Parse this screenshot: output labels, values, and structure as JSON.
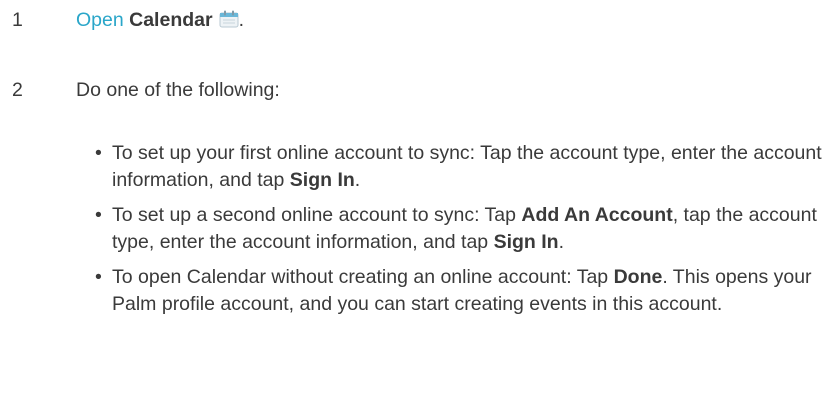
{
  "steps": [
    {
      "number": "1",
      "link_text": "Open",
      "app_name": "Calendar",
      "suffix": "."
    },
    {
      "number": "2",
      "text": "Do one of the following:"
    }
  ],
  "bullet_symbol": "•",
  "bullets": [
    {
      "lead": "To set up your first online account to sync: Tap the account type, enter the account information, and tap ",
      "bold": "Sign In",
      "tail": "."
    },
    {
      "part1": "To set up a second online account to sync: Tap ",
      "bold1": "Add An Account",
      "part2": ", tap the account type, enter the account information, and tap ",
      "bold2": "Sign In",
      "tail": "."
    },
    {
      "part1": "To open Calendar without creating an online account: Tap ",
      "bold1": "Done",
      "part2": ". This opens your Palm profile account, and you can start creating events in this account."
    }
  ],
  "colors": {
    "link": "#2aa6c9",
    "text": "#3a3a3a",
    "calendar_icon_header": "#6ab7d8"
  },
  "icons": {
    "calendar": "calendar-icon"
  }
}
